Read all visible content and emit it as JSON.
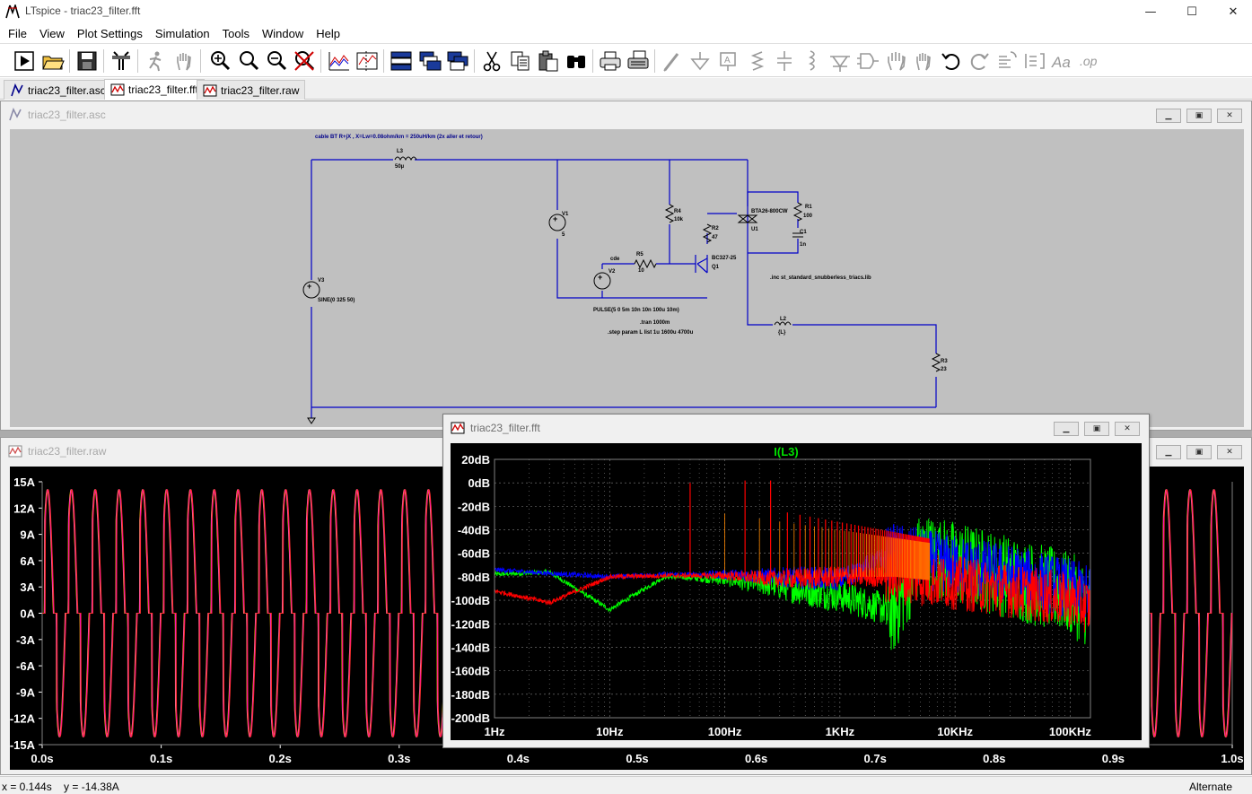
{
  "window": {
    "title": "LTspice - triac23_filter.fft",
    "minimize": "—",
    "maximize": "☐",
    "close": "✕"
  },
  "menu": [
    "File",
    "View",
    "Plot Settings",
    "Simulation",
    "Tools",
    "Window",
    "Help"
  ],
  "tabs": [
    {
      "label": "triac23_filter.asc",
      "icon": "schematic-icon",
      "active": false
    },
    {
      "label": "triac23_filter.fft",
      "icon": "waveform-icon",
      "active": true
    },
    {
      "label": "triac23_filter.raw",
      "icon": "waveform-icon",
      "active": false
    }
  ],
  "toolbar": {
    "icons": [
      "run-icon",
      "open-icon",
      "save-icon",
      "control-panel-icon",
      "halt-icon",
      "pan-hand-icon",
      "zoom-in-icon",
      "zoom-area-icon",
      "zoom-out-icon",
      "zoom-cancel-icon",
      "autorange-icon",
      "mark-data-icon",
      "tile-horizontal-icon",
      "cascade-icon",
      "tile-vertical-icon",
      "cut-icon",
      "copy-icon",
      "paste-icon",
      "find-icon",
      "print-icon",
      "print-setup-icon",
      "draw-wire-icon",
      "ground-icon",
      "label-net-icon",
      "resistor-icon",
      "capacitor-icon",
      "inductor-icon",
      "diode-icon",
      "component-icon",
      "move-icon",
      "drag-icon",
      "undo-icon",
      "redo-icon",
      "rotate-icon",
      "mirror-icon",
      "text-icon",
      "spice-directive-icon"
    ]
  },
  "schematic": {
    "title": "triac23_filter.asc",
    "comment": "cable BT R+jX , X=Lw=0.08ohm/km = 250uH/km (2x aller et retour)",
    "components": {
      "L3": {
        "name": "L3",
        "value": "50µ"
      },
      "V1": {
        "name": "V1",
        "value": "5"
      },
      "V2": {
        "name": "V2",
        "value": "PULSE(5 0 5m 10n 10n 100u 10m)"
      },
      "V3": {
        "name": "V3",
        "value": "SINE(0 325 50)"
      },
      "R4": {
        "name": "R4",
        "value": "10k"
      },
      "R5": {
        "name": "R5",
        "value": "10"
      },
      "R2": {
        "name": "R2",
        "value": "47"
      },
      "Q1": {
        "name": "Q1",
        "value": "BC327-25"
      },
      "U1": {
        "name": "U1",
        "value": "BTA26-800CW"
      },
      "R1": {
        "name": "R1",
        "value": "100"
      },
      "C1": {
        "name": "C1",
        "value": "1n"
      },
      "L2": {
        "name": "L2",
        "value": "{L}"
      },
      "R3": {
        "name": "R3",
        "value": "23"
      }
    },
    "net_label": "cde",
    "directives": {
      "include": ".inc st_standard_snubberless_triacs.lib",
      "tran": ".tran 1000m",
      "step": ".step param L list 1u 1600u 4700u"
    }
  },
  "raw": {
    "title": "triac23_filter.raw",
    "y_ticks": [
      "15A",
      "12A",
      "9A",
      "6A",
      "3A",
      "0A",
      "-3A",
      "-6A",
      "-9A",
      "-12A",
      "-15A"
    ],
    "x_ticks": [
      "0.0s",
      "0.1s",
      "0.2s",
      "0.3s",
      "0.4s",
      "0.5s",
      "0.6s",
      "0.7s",
      "0.8s",
      "0.9s",
      "1.0s"
    ],
    "colors": {
      "trace1": "#ff3030",
      "trace2": "#ffd000",
      "trace3": "#ff00ff"
    }
  },
  "fft": {
    "title": "triac23_filter.fft",
    "trace_label": "I(L3)",
    "trace_label_color": "#00e000",
    "y_ticks": [
      "20dB",
      "0dB",
      "-20dB",
      "-40dB",
      "-60dB",
      "-80dB",
      "-100dB",
      "-120dB",
      "-140dB",
      "-160dB",
      "-180dB",
      "-200dB"
    ],
    "x_ticks": [
      "1Hz",
      "10Hz",
      "100Hz",
      "1KHz",
      "10KHz",
      "100KHz"
    ],
    "colors": {
      "green": "#00ff00",
      "blue": "#0000ff",
      "red": "#ff0000",
      "grid": "#808080"
    }
  },
  "chart_data": [
    {
      "type": "line",
      "title": "I(L3)",
      "xlabel": "",
      "ylabel": "",
      "x_scale": "log",
      "xlim": [
        1,
        150000
      ],
      "ylim": [
        -200,
        20
      ],
      "x_ticks": [
        "1Hz",
        "10Hz",
        "100Hz",
        "1KHz",
        "10KHz",
        "100KHz"
      ],
      "y_ticks": [
        "20dB",
        "0dB",
        "-20dB",
        "-40dB",
        "-60dB",
        "-80dB",
        "-100dB",
        "-120dB",
        "-140dB",
        "-160dB",
        "-180dB",
        "-200dB"
      ],
      "grid": true,
      "series": [
        {
          "color": "#00ff00",
          "x": [
            1,
            3,
            10,
            30,
            100,
            300,
            1000,
            3000,
            5000,
            10000,
            30000,
            100000,
            150000
          ],
          "y": [
            -78,
            -76,
            -108,
            -80,
            -82,
            -88,
            -96,
            -110,
            -60,
            -68,
            -80,
            -95,
            -105
          ]
        },
        {
          "color": "#0000ff",
          "x": [
            1,
            3,
            10,
            30,
            100,
            300,
            1000,
            3000,
            10000,
            30000,
            100000,
            150000
          ],
          "y": [
            -74,
            -77,
            -80,
            -78,
            -78,
            -80,
            -82,
            -60,
            -70,
            -78,
            -90,
            -96
          ]
        },
        {
          "color": "#ff0000",
          "x": [
            1,
            3,
            10,
            30,
            100,
            300,
            1000,
            3000,
            10000,
            30000,
            100000,
            150000
          ],
          "y": [
            -92,
            -102,
            -80,
            -79,
            -79,
            -82,
            -80,
            -80,
            -85,
            -92,
            -100,
            -106
          ]
        }
      ]
    },
    {
      "type": "line",
      "xlabel": "",
      "ylabel": "",
      "xlim": [
        0,
        1
      ],
      "ylim": [
        -15,
        15
      ],
      "x_ticks": [
        "0.0s",
        "0.1s",
        "0.2s",
        "0.3s",
        "0.4s",
        "0.5s",
        "0.6s",
        "0.7s",
        "0.8s",
        "0.9s",
        "1.0s"
      ],
      "y_ticks": [
        "15A",
        "12A",
        "9A",
        "6A",
        "3A",
        "0A",
        "-3A",
        "-6A",
        "-9A",
        "-12A",
        "-15A"
      ],
      "grid": false,
      "period_s": 0.02,
      "peak_A": 14.1
    }
  ],
  "status": {
    "coords": "x = 0.144s    y = -14.38A",
    "mode": "Alternate"
  }
}
